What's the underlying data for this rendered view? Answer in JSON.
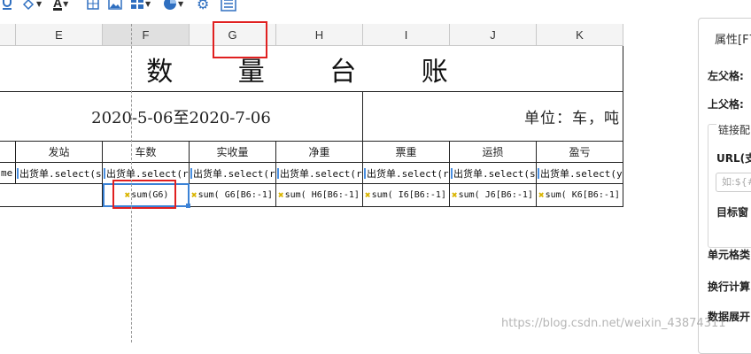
{
  "toolbar": {
    "icons": [
      "underline-icon",
      "fill-color-icon",
      "font-color-icon",
      "border-icon",
      "image-icon",
      "barcode-icon",
      "chart-icon",
      "settings-icon",
      "document-icon"
    ],
    "font_color_letter": "A",
    "accent": "#2f6fc0"
  },
  "columns": [
    "E",
    "F",
    "G",
    "H",
    "I",
    "J",
    "K"
  ],
  "selected_column": "F",
  "report": {
    "title": "数 量 台 账",
    "date_range": "2020-5-06至2020-7-06",
    "unit": "单位：车，吨",
    "headers": [
      "发站",
      "车数",
      "实收量",
      "净重",
      "票重",
      "运损",
      "盈亏"
    ],
    "row6": {
      "left_fragment": "me",
      "cells": [
        "出货单.select(s",
        "出货单.select(r",
        "出货单.select(r",
        "出货单.select(r",
        "出货单.select(r",
        "出货单.select(s",
        "出货单.select(y"
      ]
    },
    "row7": {
      "cells": [
        "sum(G6)",
        "sum( G6[B6:-1]",
        "sum( H6[B6:-1]",
        "sum( I6[B6:-1]",
        "sum( J6[B6:-1]",
        "sum( K6[B6:-1]"
      ]
    }
  },
  "panel": {
    "header": "属性[F7",
    "left_parent": "左父格:",
    "top_parent": "上父格:",
    "link_group": "链接配",
    "url_label": "URL(支",
    "url_placeholder": "如:${#",
    "target_label": "目标窗",
    "cell_type_label": "单元格类",
    "wrap_calc_label": "换行计算",
    "expand_label": "数据展开"
  },
  "watermark": "https://blog.csdn.net/weixin_43874311",
  "highlight_color": "#e02020",
  "selection_color": "#3b82d6"
}
